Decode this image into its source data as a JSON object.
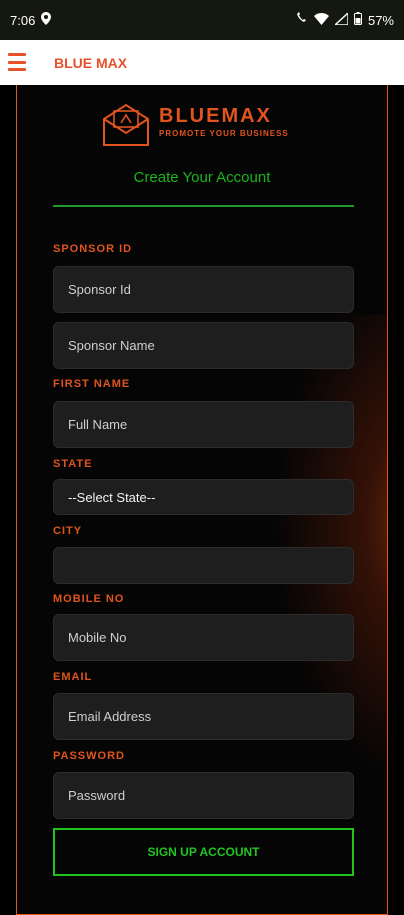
{
  "status_bar": {
    "time": "7:06",
    "battery": "57%"
  },
  "app_bar": {
    "title": "BLUE MAX"
  },
  "logo": {
    "text": "BLUEMAX",
    "tagline": "PROMOTE YOUR BUSINESS"
  },
  "form": {
    "heading": "Create Your Account",
    "sponsor_label": "SPONSOR ID",
    "sponsor_id_placeholder": "Sponsor Id",
    "sponsor_name_placeholder": "Sponsor Name",
    "first_name_label": "FIRST NAME",
    "full_name_placeholder": "Full Name",
    "state_label": "STATE",
    "state_selected": "--Select State--",
    "city_label": "CITY",
    "city_value": "",
    "mobile_label": "MOBILE NO",
    "mobile_placeholder": "Mobile No",
    "email_label": "EMAIL",
    "email_placeholder": "Email Address",
    "password_label": "PASSWORD",
    "password_placeholder": "Password",
    "signup_button": "SIGN UP ACCOUNT"
  },
  "colors": {
    "accent": "#e1541e",
    "green": "#22c422",
    "field_bg": "#1e1e1e"
  }
}
